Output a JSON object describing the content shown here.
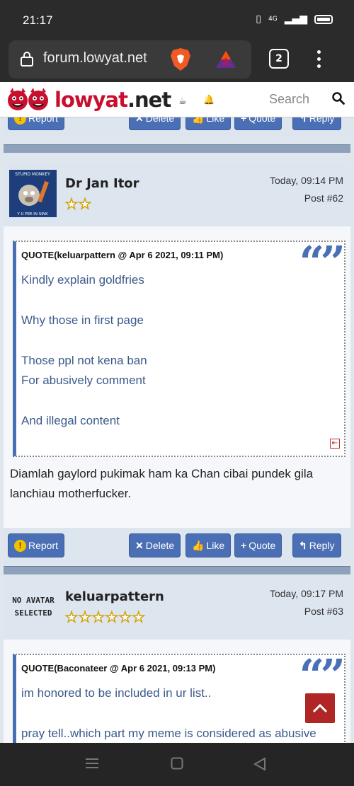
{
  "status_bar": {
    "time": "21:17",
    "network": "4G"
  },
  "browser": {
    "url": "forum.lowyat.net",
    "tab_count": "2"
  },
  "header": {
    "logo_text": "lowyat",
    "logo_suffix": ".net",
    "search_placeholder": "Search"
  },
  "top_actions": {
    "report": "Report",
    "delete": "Delete",
    "like": "Like",
    "quote": "Quote",
    "reply": "Reply"
  },
  "post1": {
    "avatar_top_text": "STUPID MONKEY",
    "avatar_bottom_text": "Y U PEE IN SINK",
    "author": "Dr Jan Itor",
    "star_count": 2,
    "time": "Today, 09:14 PM",
    "post_number": "Post #62",
    "quote_header": "QUOTE(keluarpattern @ Apr 6 2021, 09:11 PM)",
    "quote_lines": [
      "Kindly explain goldfries",
      "Why those in first page",
      "Those ppl not kena ban",
      "For abusively comment",
      "And illegal content"
    ],
    "reply_text": "Diamlah gaylord pukimak ham ka Chan cibai pundek gila lanchiau motherfucker.",
    "actions": {
      "report": "Report",
      "delete": "Delete",
      "like": "Like",
      "quote": "Quote",
      "reply": "Reply"
    }
  },
  "post2": {
    "no_avatar_line1": "NO AVATAR",
    "no_avatar_line2": "SELECTED",
    "author": "keluarpattern",
    "star_count": 6,
    "time": "Today, 09:17 PM",
    "post_number": "Post #63",
    "quote_header": "QUOTE(Baconateer @ Apr 6 2021, 09:13 PM)",
    "quote_lines": [
      "im honored to be included in ur list..",
      "pray tell..which part my meme is considered as abusive"
    ]
  },
  "colors": {
    "button_blue": "#4a6fb5",
    "brand_red": "#c8102e",
    "star_gold": "#d4a20a",
    "scroll_red": "#b02626"
  }
}
